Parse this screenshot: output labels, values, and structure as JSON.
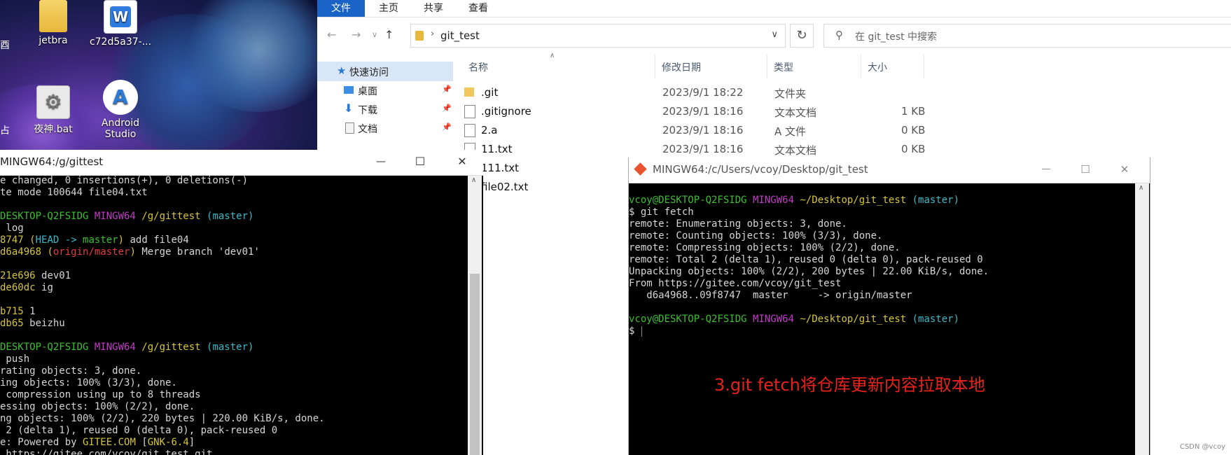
{
  "desktop": {
    "icons": [
      {
        "label": "jetbra",
        "icon": "folder-icon"
      },
      {
        "label": "c72d5a37-...",
        "icon": "wps-icon"
      },
      {
        "label": "夜神.bat",
        "icon": "gear-icon"
      },
      {
        "label": "Android Studio",
        "icon": "android-studio-icon"
      }
    ],
    "edge_label_top": "酉",
    "edge_label_mid": "占"
  },
  "explorer": {
    "ribbon_tabs": [
      "文件",
      "主页",
      "共享",
      "查看"
    ],
    "active_tab": "文件",
    "address": "git_test",
    "search_placeholder": "在 git_test 中搜索",
    "nav_items": [
      "快速访问",
      "桌面",
      "下载",
      "文档"
    ],
    "columns": {
      "name": "名称",
      "date": "修改日期",
      "type": "类型",
      "size": "大小"
    },
    "files": [
      {
        "name": ".git",
        "date": "2023/9/1 18:22",
        "type": "文件夹",
        "size": "",
        "icon": "folder-icon"
      },
      {
        "name": ".gitignore",
        "date": "2023/9/1 18:16",
        "type": "文本文档",
        "size": "1 KB",
        "icon": "text-file-icon"
      },
      {
        "name": "2.a",
        "date": "2023/9/1 18:16",
        "type": "A 文件",
        "size": "0 KB",
        "icon": "file-icon"
      },
      {
        "name": "11.txt",
        "date": "2023/9/1 18:16",
        "type": "文本文档",
        "size": "0 KB",
        "icon": "text-file-icon"
      },
      {
        "name": "111.txt",
        "date": "",
        "type": "",
        "size": "",
        "icon": "text-file-icon"
      },
      {
        "name": "file02.txt",
        "date": "",
        "type": "",
        "size": "",
        "icon": "text-file-icon"
      }
    ]
  },
  "term_left": {
    "title": "MINGW64:/g/gittest",
    "lines": [
      [
        {
          "t": "e changed, 0 insertions(+), 0 deletions(-)",
          "c": ""
        }
      ],
      [
        {
          "t": "te mode 100644 file04.txt",
          "c": ""
        }
      ],
      [
        {
          "t": "",
          "c": ""
        }
      ],
      [
        {
          "t": "DESKTOP-Q2FSIDG ",
          "c": "green"
        },
        {
          "t": "MINGW64 ",
          "c": "magenta"
        },
        {
          "t": "/g/gittest ",
          "c": "yellow"
        },
        {
          "t": "(master)",
          "c": "cyan"
        }
      ],
      [
        {
          "t": " log",
          "c": ""
        }
      ],
      [
        {
          "t": "8747 ",
          "c": "yellow"
        },
        {
          "t": "(",
          "c": "yellow"
        },
        {
          "t": "HEAD -> ",
          "c": "cyan"
        },
        {
          "t": "master",
          "c": "green"
        },
        {
          "t": ")",
          "c": "yellow"
        },
        {
          "t": " add file04",
          "c": ""
        }
      ],
      [
        {
          "t": "d6a4968 ",
          "c": "yellow"
        },
        {
          "t": "(",
          "c": "yellow"
        },
        {
          "t": "origin/master",
          "c": "red"
        },
        {
          "t": ")",
          "c": "yellow"
        },
        {
          "t": " Merge branch 'dev01'",
          "c": ""
        }
      ],
      [
        {
          "t": "",
          "c": ""
        }
      ],
      [
        {
          "t": "21e696 ",
          "c": "yellow"
        },
        {
          "t": "dev01",
          "c": ""
        }
      ],
      [
        {
          "t": "de60dc ",
          "c": "yellow"
        },
        {
          "t": "ig",
          "c": ""
        }
      ],
      [
        {
          "t": "",
          "c": ""
        }
      ],
      [
        {
          "t": "b715 ",
          "c": "yellow"
        },
        {
          "t": "1",
          "c": ""
        }
      ],
      [
        {
          "t": "db65 ",
          "c": "yellow"
        },
        {
          "t": "beizhu",
          "c": ""
        }
      ],
      [
        {
          "t": "",
          "c": ""
        }
      ],
      [
        {
          "t": "DESKTOP-Q2FSIDG ",
          "c": "green"
        },
        {
          "t": "MINGW64 ",
          "c": "magenta"
        },
        {
          "t": "/g/gittest ",
          "c": "yellow"
        },
        {
          "t": "(master)",
          "c": "cyan"
        }
      ],
      [
        {
          "t": " push",
          "c": ""
        }
      ],
      [
        {
          "t": "rating objects: 3, done.",
          "c": ""
        }
      ],
      [
        {
          "t": "ing objects: 100% (3/3), done.",
          "c": ""
        }
      ],
      [
        {
          "t": " compression using up to 8 threads",
          "c": ""
        }
      ],
      [
        {
          "t": "essing objects: 100% (2/2), done.",
          "c": ""
        }
      ],
      [
        {
          "t": "ng objects: 100% (2/2), 220 bytes | 220.00 KiB/s, done.",
          "c": ""
        }
      ],
      [
        {
          "t": " 2 (delta 1), reused 0 (delta 0), pack-reused 0",
          "c": ""
        }
      ],
      [
        {
          "t": "e: Powered by ",
          "c": ""
        },
        {
          "t": "GITEE.COM ",
          "c": "yellow"
        },
        {
          "t": "[",
          "c": ""
        },
        {
          "t": "GNK-6.4",
          "c": "yellow"
        },
        {
          "t": "]",
          "c": ""
        }
      ],
      [
        {
          "t": " https://gitee.com/vcoy/git_test.git",
          "c": ""
        }
      ]
    ]
  },
  "term_right": {
    "title": "MINGW64:/c/Users/vcoy/Desktop/git_test",
    "lines": [
      [
        {
          "t": "vcoy@DESKTOP-Q2FSIDG ",
          "c": "green"
        },
        {
          "t": "MINGW64 ",
          "c": "magenta"
        },
        {
          "t": "~/Desktop/git_test ",
          "c": "yellow"
        },
        {
          "t": "(master)",
          "c": "cyan"
        }
      ],
      [
        {
          "t": "$ git fetch",
          "c": ""
        }
      ],
      [
        {
          "t": "remote: Enumerating objects: 3, done.",
          "c": ""
        }
      ],
      [
        {
          "t": "remote: Counting objects: 100% (3/3), done.",
          "c": ""
        }
      ],
      [
        {
          "t": "remote: Compressing objects: 100% (2/2), done.",
          "c": ""
        }
      ],
      [
        {
          "t": "remote: Total 2 (delta 1), reused 0 (delta 0), pack-reused 0",
          "c": ""
        }
      ],
      [
        {
          "t": "Unpacking objects: 100% (2/2), 200 bytes | 22.00 KiB/s, done.",
          "c": ""
        }
      ],
      [
        {
          "t": "From https://gitee.com/vcoy/git_test",
          "c": ""
        }
      ],
      [
        {
          "t": "   d6a4968..09f8747  master     -> origin/master",
          "c": ""
        }
      ],
      [
        {
          "t": "",
          "c": ""
        }
      ],
      [
        {
          "t": "vcoy@DESKTOP-Q2FSIDG ",
          "c": "green"
        },
        {
          "t": "MINGW64 ",
          "c": "magenta"
        },
        {
          "t": "~/Desktop/git_test ",
          "c": "yellow"
        },
        {
          "t": "(master)",
          "c": "cyan"
        }
      ],
      [
        {
          "t": "$ ",
          "c": ""
        }
      ]
    ],
    "annotation": "3.git fetch将仓库更新内容拉取本地"
  },
  "window_buttons": {
    "minimize": "—",
    "maximize": "☐",
    "close": "✕"
  },
  "watermark": "CSDN @vcoy",
  "colors": {
    "accent": "#1a64c8",
    "terminal_bg": "#000000",
    "annotation": "#e8221b"
  }
}
